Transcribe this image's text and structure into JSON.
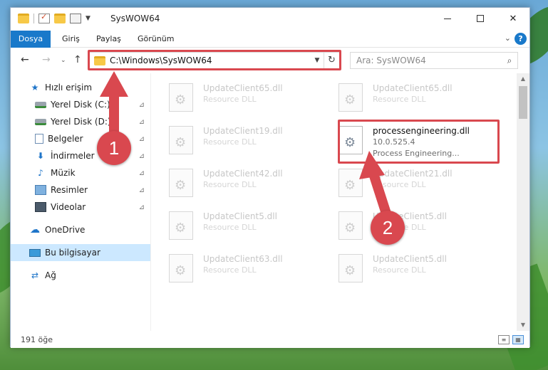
{
  "window": {
    "title": "SysWOW64",
    "controls": {
      "minimize": "—",
      "maximize": "",
      "close": "✕"
    }
  },
  "ribbon": {
    "tabs": [
      {
        "label": "Dosya",
        "active": true
      },
      {
        "label": "Giriş",
        "active": false
      },
      {
        "label": "Paylaş",
        "active": false
      },
      {
        "label": "Görünüm",
        "active": false
      }
    ],
    "help": "?",
    "expand_chevron": "⌄"
  },
  "address": {
    "path": "C:\\Windows\\SysWOW64",
    "search_placeholder": "Ara: SysWOW64"
  },
  "nav": {
    "back": "←",
    "forward": "→",
    "recent": "⌄",
    "up": "↑",
    "refresh": "↻",
    "search_icon": "⌕"
  },
  "sidebar": {
    "items": [
      {
        "label": "Hızlı erişim",
        "icon": "star-icon",
        "pinned": false,
        "selected": false
      },
      {
        "label": "Yerel Disk (C:)",
        "icon": "disk-icon",
        "pinned": true,
        "selected": false
      },
      {
        "label": "Yerel Disk (D:)",
        "icon": "disk-icon",
        "pinned": true,
        "selected": false
      },
      {
        "label": "Belgeler",
        "icon": "documents-icon",
        "pinned": true,
        "selected": false
      },
      {
        "label": "İndirmeler",
        "icon": "download-icon",
        "pinned": true,
        "selected": false
      },
      {
        "label": "Müzik",
        "icon": "music-icon",
        "pinned": true,
        "selected": false
      },
      {
        "label": "Resimler",
        "icon": "pictures-icon",
        "pinned": true,
        "selected": false
      },
      {
        "label": "Videolar",
        "icon": "videos-icon",
        "pinned": true,
        "selected": false
      },
      {
        "label": "OneDrive",
        "icon": "cloud-icon",
        "pinned": false,
        "selected": false
      },
      {
        "label": "Bu bilgisayar",
        "icon": "computer-icon",
        "pinned": false,
        "selected": true
      },
      {
        "label": "Ağ",
        "icon": "network-icon",
        "pinned": false,
        "selected": false
      }
    ],
    "pin_glyph": "📌"
  },
  "files": [
    {
      "name": "UpdateClient65.dll",
      "sub": "Resource DLL",
      "sub2": "",
      "faded": true
    },
    {
      "name": "UpdateClient65.dll",
      "sub": "Resource DLL",
      "sub2": "",
      "faded": true
    },
    {
      "name": "UpdateClient19.dll",
      "sub": "Resource DLL",
      "sub2": "",
      "faded": true
    },
    {
      "name": "processengineering.dll",
      "sub": "10.0.525.4",
      "sub2": "Process Engineering...",
      "faded": false
    },
    {
      "name": "UpdateClient42.dll",
      "sub": "Resource DLL",
      "sub2": "",
      "faded": true
    },
    {
      "name": "UpdateClient21.dll",
      "sub": "Resource DLL",
      "sub2": "",
      "faded": true
    },
    {
      "name": "UpdateClient5.dll",
      "sub": "Resource DLL",
      "sub2": "",
      "faded": true
    },
    {
      "name": "UpdateClient5.dll",
      "sub": "Resource DLL",
      "sub2": "",
      "faded": true
    },
    {
      "name": "UpdateClient63.dll",
      "sub": "Resource DLL",
      "sub2": "",
      "faded": true
    },
    {
      "name": "UpdateClient5.dll",
      "sub": "Resource DLL",
      "sub2": "",
      "faded": true
    }
  ],
  "status": {
    "count": "191 öğe"
  },
  "annotations": {
    "step1": "1",
    "step2": "2",
    "color": "#d9484f"
  },
  "colors": {
    "accent": "#1979ca",
    "selection": "#cce8ff",
    "annotation": "#d9484f"
  }
}
